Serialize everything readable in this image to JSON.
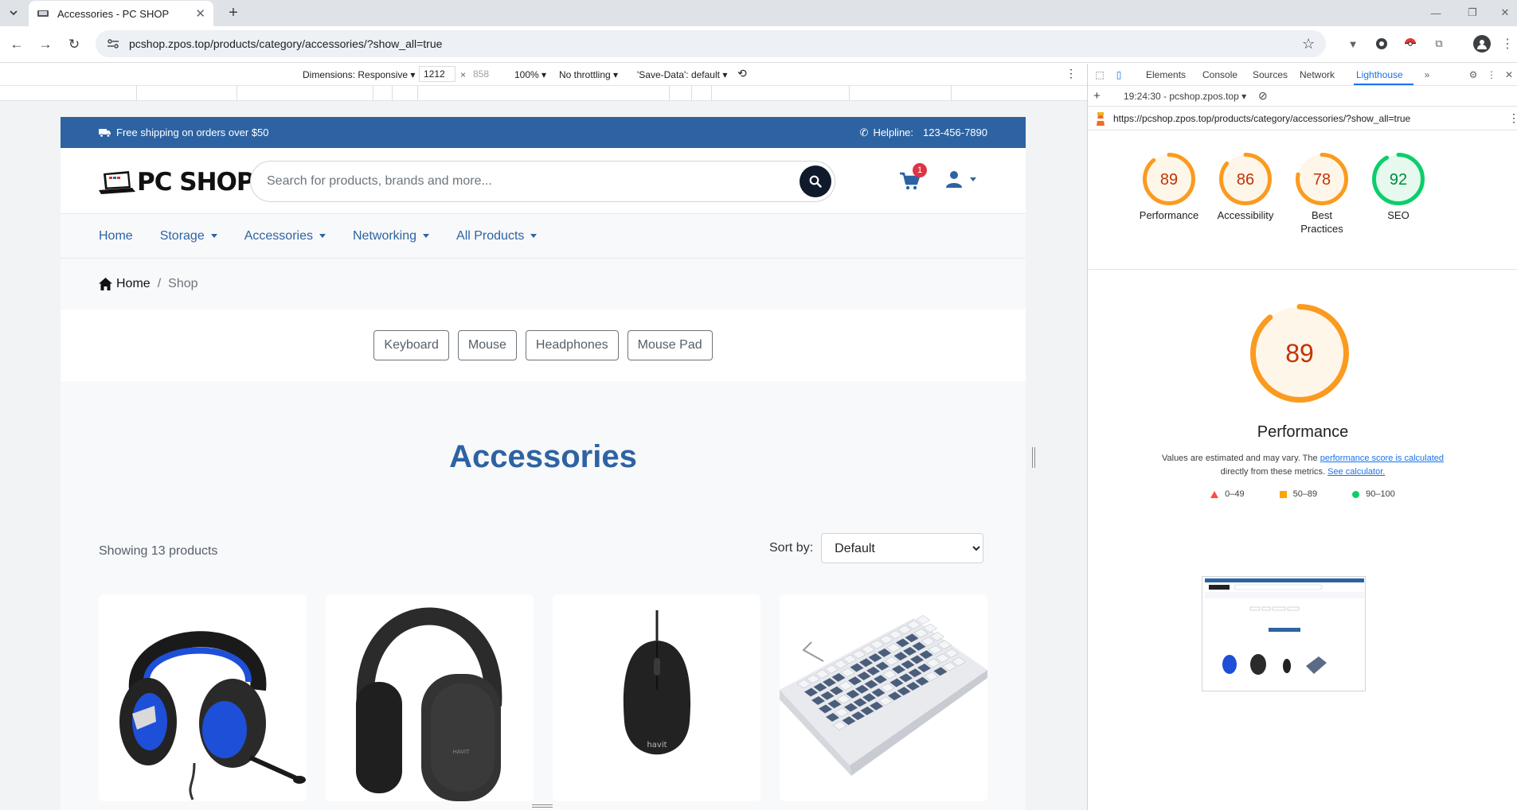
{
  "browser": {
    "tab_title": "Accessories - PC SHOP",
    "url": "pcshop.zpos.top/products/category/accessories/?show_all=true",
    "icons": [
      "tab-search-icon",
      "close-icon",
      "new-tab-icon",
      "back-icon",
      "forward-icon",
      "reload-icon",
      "site-info-icon",
      "bookmark-star-icon",
      "profile-avatar-icon",
      "more-menu-icon"
    ]
  },
  "device_toolbar": {
    "dimensions_label": "Dimensions: Responsive",
    "width": "1212",
    "times": "×",
    "height_placeholder": "858",
    "zoom": "100%",
    "throttling": "No throttling",
    "save_data": "'Save-Data': default"
  },
  "site": {
    "colors": {
      "brand_blue": "#2d63a2",
      "dark": "#0f1a2b",
      "badge_red": "#dc3545"
    },
    "topbar": {
      "shipping": "Free shipping on orders over $50",
      "helpline_label": "Helpline:",
      "helpline_number": "123-456-7890"
    },
    "logo_text": "PC SHOP",
    "search_placeholder": "Search for products, brands and more...",
    "cart_count": "1",
    "nav": [
      "Home",
      "Storage",
      "Accessories",
      "Networking",
      "All Products"
    ],
    "breadcrumb": {
      "home": "Home",
      "sep": "/",
      "current": "Shop"
    },
    "filters": [
      "Keyboard",
      "Mouse",
      "Headphones",
      "Mouse Pad"
    ],
    "category_title": "Accessories",
    "showing": "Showing 13 products",
    "sort_label": "Sort by:",
    "sort_value": "Default",
    "products": [
      {
        "name": "gaming-headset",
        "brand_mark": ""
      },
      {
        "name": "wireless-headphones",
        "brand_mark": "HAVIT"
      },
      {
        "name": "wired-mouse",
        "brand_mark": "havit"
      },
      {
        "name": "mechanical-keyboard",
        "brand_mark": ""
      }
    ]
  },
  "devtools": {
    "tabs": [
      "Elements",
      "Console",
      "Sources",
      "Network",
      "Lighthouse"
    ],
    "active_tab": "Lighthouse",
    "run_label": "19:24:30 - pcshop.zpos.top",
    "report_url": "https://pcshop.zpos.top/products/category/accessories/?show_all=true",
    "scores": [
      {
        "label": "Performance",
        "value": 89,
        "color": "#fa9b20"
      },
      {
        "label": "Accessibility",
        "value": 86,
        "color": "#fa9b20"
      },
      {
        "label": "Best Practices",
        "value": 78,
        "color": "#fa9b20"
      },
      {
        "label": "SEO",
        "value": 92,
        "color": "#0cce6b"
      }
    ],
    "big_score": "89",
    "big_title": "Performance",
    "desc_1": "Values are estimated and may vary. The ",
    "desc_link_1": "performance score is calculated",
    "desc_2": " directly from these metrics. ",
    "desc_link_2": "See calculator.",
    "legend": [
      {
        "range": "0–49",
        "color": "#ff4e42"
      },
      {
        "range": "50–89",
        "color": "#ffa400"
      },
      {
        "range": "90–100",
        "color": "#0cce6b"
      }
    ]
  }
}
